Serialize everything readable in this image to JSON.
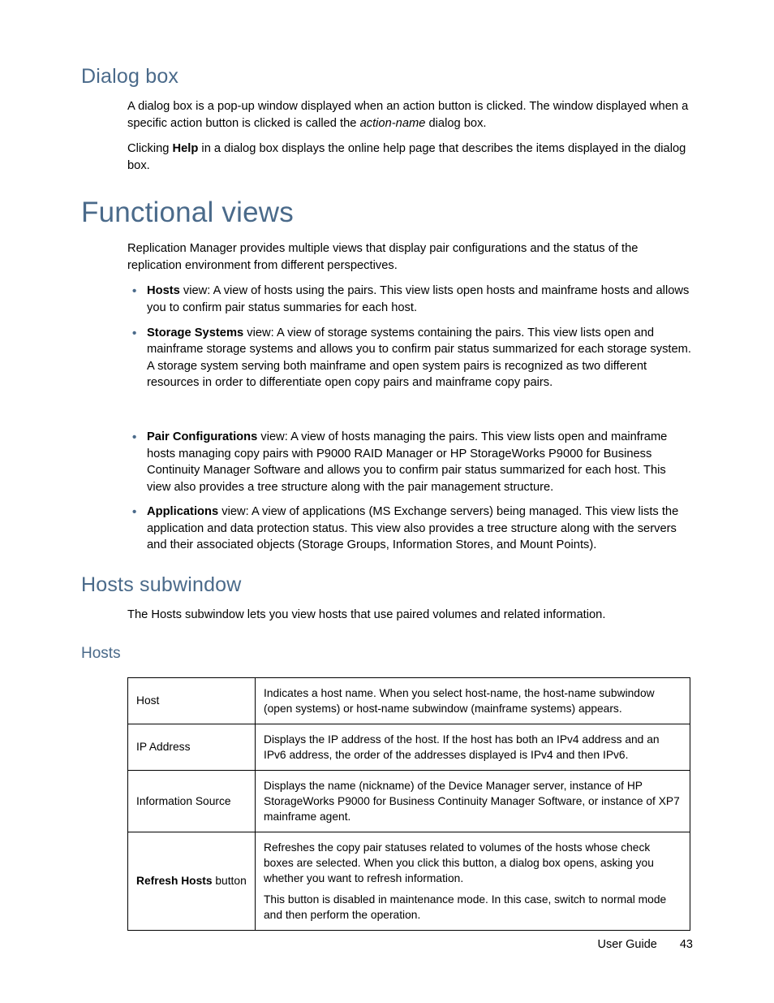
{
  "sections": {
    "dialog_box": {
      "title": "Dialog box",
      "p1_a": "A dialog box is a pop-up window displayed when an action button is clicked. The window displayed when a specific action button is clicked is called the ",
      "p1_italic": "action-name",
      "p1_b": " dialog box.",
      "p2_a": "Clicking ",
      "p2_bold": "Help",
      "p2_b": " in a dialog box displays the online help page that describes the items displayed in the dialog box."
    },
    "functional_views": {
      "title": "Functional views",
      "intro": "Replication Manager provides multiple views that display pair configurations and the status of the replication environment from different perspectives.",
      "bullets": [
        {
          "bold": "Hosts",
          "rest": " view: A view of hosts using the pairs. This view lists open hosts and mainframe hosts and allows you to confirm pair status summaries for each host."
        },
        {
          "bold": "Storage Systems",
          "rest": " view: A view of storage systems containing the pairs. This view lists open and mainframe storage systems and allows you to confirm pair status summarized for each storage system. A storage system serving both mainframe and open system pairs is recognized as two different resources in order to differentiate open copy pairs and mainframe copy pairs."
        },
        {
          "bold": "Pair Configurations",
          "rest": " view: A view of hosts managing the pairs. This view lists open and mainframe hosts managing copy pairs with P9000 RAID Manager or HP StorageWorks P9000 for Business Continuity Manager Software and allows you to confirm pair status summarized for each host. This view also provides a tree structure along with the pair management structure."
        },
        {
          "bold": "Applications",
          "rest": " view: A view of applications (MS Exchange servers) being managed. This view lists the application and data protection status. This view also provides a tree structure along with the servers and their associated objects (Storage Groups, Information Stores, and Mount Points)."
        }
      ]
    },
    "hosts_subwindow": {
      "title": "Hosts subwindow",
      "intro": "The Hosts subwindow lets you view hosts that use paired volumes and related information.",
      "table_title": "Hosts",
      "rows": [
        {
          "label": "Host",
          "desc": "Indicates a host name. When you select host-name, the host-name subwindow (open systems) or host-name subwindow (mainframe systems) appears."
        },
        {
          "label": "IP Address",
          "desc": "Displays the IP address of the host. If the host has both an IPv4 address and an IPv6 address, the order of the addresses displayed is IPv4 and then IPv6."
        },
        {
          "label": "Information Source",
          "desc": "Displays the name (nickname) of the Device Manager server, instance of HP StorageWorks P9000 for Business Continuity Manager Software, or instance of XP7 mainframe agent."
        },
        {
          "label_bold": "Refresh Hosts",
          "label_rest": " button",
          "desc": "Refreshes the copy pair statuses related to volumes of the hosts whose check boxes are selected. When you click this button, a dialog box opens, asking you whether you want to refresh information.",
          "desc2": "This button is disabled in maintenance mode. In this case, switch to normal mode and then perform the operation."
        }
      ]
    }
  },
  "footer": {
    "doc": "User Guide",
    "page": "43"
  }
}
